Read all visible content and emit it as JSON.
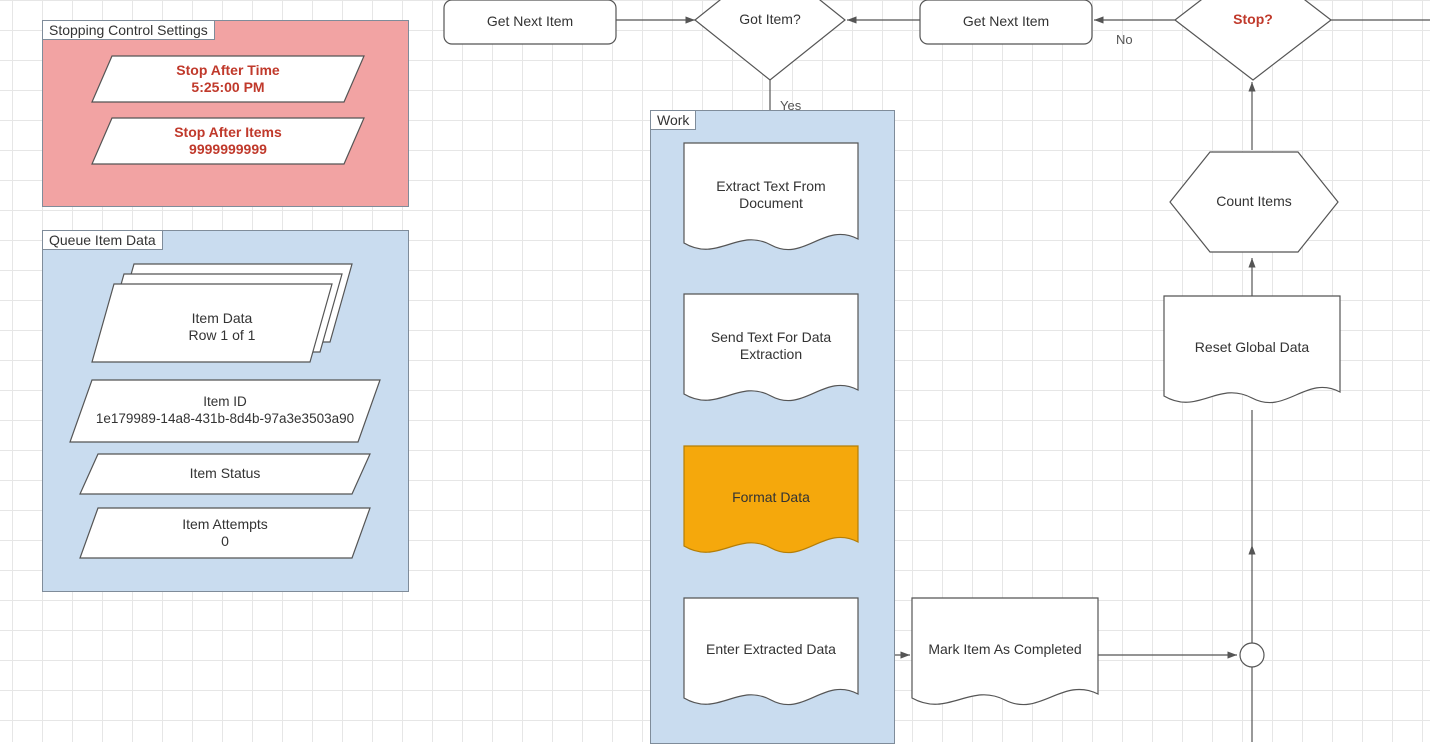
{
  "top": {
    "getNextLeft": "Get Next Item",
    "gotItem": "Got Item?",
    "getNextRight": "Get Next Item",
    "stop": "Stop?",
    "yes": "Yes",
    "no": "No"
  },
  "stopping": {
    "title": "Stopping Control Settings",
    "afterTime": "Stop After Time\n5:25:00 PM",
    "afterItems": "Stop After Items\n9999999999"
  },
  "queue": {
    "title": "Queue Item Data",
    "itemData": "Item Data\nRow 1 of 1",
    "itemId": "Item ID\n1e179989-14a8-431b-8d4b-97a3e3503a90",
    "itemStatus": "Item Status",
    "itemAttempts": "Item Attempts\n0"
  },
  "work": {
    "title": "Work",
    "extract": "Extract Text From Document",
    "send": "Send Text For Data Extraction",
    "format": "Format Data",
    "enter": "Enter Extracted Data"
  },
  "right": {
    "countItems": "Count Items",
    "resetGlobal": "Reset Global Data",
    "markCompleted": "Mark Item As Completed"
  }
}
